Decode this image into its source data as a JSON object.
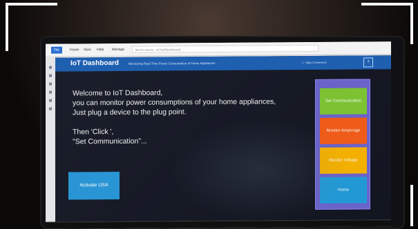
{
  "browser": {
    "tabs": [
      "File",
      "Home",
      "View",
      "Help",
      "Manage"
    ],
    "address": "file:///C:/Users/.../IoT%20Dashboard/..."
  },
  "app": {
    "title": "IoT Dashboard",
    "subtitle": "Monitoring Real Time Power Consumption of Home Appliances",
    "header_right": "1 - Main Connection",
    "header_button": "?",
    "welcome": "Welcome to IoT Dashboard,\nyou can monitor power consumptions of your home appliances,\nJust plug a device to the plug point.\n\nThen  'Click ',\n\"Set Communication\"...",
    "activate_button": "Activate USA",
    "buttons": {
      "set_communication": "Set Communication",
      "monitor_amperage": "Monitor Amperage",
      "monitor_voltage": "Monitor Voltage",
      "home": "Home"
    }
  }
}
